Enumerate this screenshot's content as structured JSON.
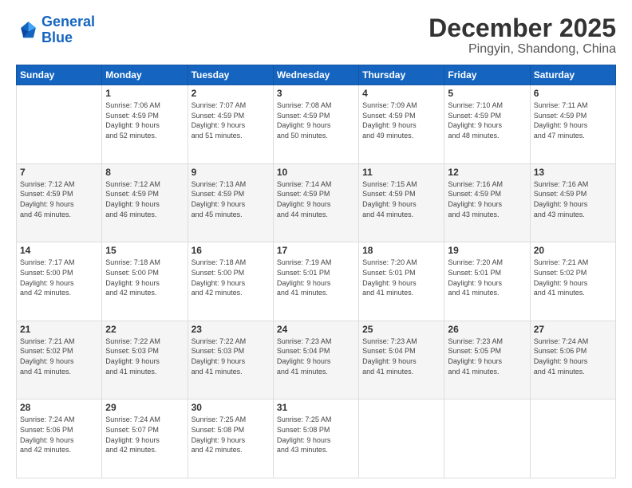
{
  "app": {
    "name1": "General",
    "name2": "Blue"
  },
  "title": "December 2025",
  "location": "Pingyin, Shandong, China",
  "days_of_week": [
    "Sunday",
    "Monday",
    "Tuesday",
    "Wednesday",
    "Thursday",
    "Friday",
    "Saturday"
  ],
  "weeks": [
    [
      {
        "day": "",
        "info": ""
      },
      {
        "day": "1",
        "info": "Sunrise: 7:06 AM\nSunset: 4:59 PM\nDaylight: 9 hours\nand 52 minutes."
      },
      {
        "day": "2",
        "info": "Sunrise: 7:07 AM\nSunset: 4:59 PM\nDaylight: 9 hours\nand 51 minutes."
      },
      {
        "day": "3",
        "info": "Sunrise: 7:08 AM\nSunset: 4:59 PM\nDaylight: 9 hours\nand 50 minutes."
      },
      {
        "day": "4",
        "info": "Sunrise: 7:09 AM\nSunset: 4:59 PM\nDaylight: 9 hours\nand 49 minutes."
      },
      {
        "day": "5",
        "info": "Sunrise: 7:10 AM\nSunset: 4:59 PM\nDaylight: 9 hours\nand 48 minutes."
      },
      {
        "day": "6",
        "info": "Sunrise: 7:11 AM\nSunset: 4:59 PM\nDaylight: 9 hours\nand 47 minutes."
      }
    ],
    [
      {
        "day": "7",
        "info": "Sunrise: 7:12 AM\nSunset: 4:59 PM\nDaylight: 9 hours\nand 46 minutes."
      },
      {
        "day": "8",
        "info": "Sunrise: 7:12 AM\nSunset: 4:59 PM\nDaylight: 9 hours\nand 46 minutes."
      },
      {
        "day": "9",
        "info": "Sunrise: 7:13 AM\nSunset: 4:59 PM\nDaylight: 9 hours\nand 45 minutes."
      },
      {
        "day": "10",
        "info": "Sunrise: 7:14 AM\nSunset: 4:59 PM\nDaylight: 9 hours\nand 44 minutes."
      },
      {
        "day": "11",
        "info": "Sunrise: 7:15 AM\nSunset: 4:59 PM\nDaylight: 9 hours\nand 44 minutes."
      },
      {
        "day": "12",
        "info": "Sunrise: 7:16 AM\nSunset: 4:59 PM\nDaylight: 9 hours\nand 43 minutes."
      },
      {
        "day": "13",
        "info": "Sunrise: 7:16 AM\nSunset: 4:59 PM\nDaylight: 9 hours\nand 43 minutes."
      }
    ],
    [
      {
        "day": "14",
        "info": "Sunrise: 7:17 AM\nSunset: 5:00 PM\nDaylight: 9 hours\nand 42 minutes."
      },
      {
        "day": "15",
        "info": "Sunrise: 7:18 AM\nSunset: 5:00 PM\nDaylight: 9 hours\nand 42 minutes."
      },
      {
        "day": "16",
        "info": "Sunrise: 7:18 AM\nSunset: 5:00 PM\nDaylight: 9 hours\nand 42 minutes."
      },
      {
        "day": "17",
        "info": "Sunrise: 7:19 AM\nSunset: 5:01 PM\nDaylight: 9 hours\nand 41 minutes."
      },
      {
        "day": "18",
        "info": "Sunrise: 7:20 AM\nSunset: 5:01 PM\nDaylight: 9 hours\nand 41 minutes."
      },
      {
        "day": "19",
        "info": "Sunrise: 7:20 AM\nSunset: 5:01 PM\nDaylight: 9 hours\nand 41 minutes."
      },
      {
        "day": "20",
        "info": "Sunrise: 7:21 AM\nSunset: 5:02 PM\nDaylight: 9 hours\nand 41 minutes."
      }
    ],
    [
      {
        "day": "21",
        "info": "Sunrise: 7:21 AM\nSunset: 5:02 PM\nDaylight: 9 hours\nand 41 minutes."
      },
      {
        "day": "22",
        "info": "Sunrise: 7:22 AM\nSunset: 5:03 PM\nDaylight: 9 hours\nand 41 minutes."
      },
      {
        "day": "23",
        "info": "Sunrise: 7:22 AM\nSunset: 5:03 PM\nDaylight: 9 hours\nand 41 minutes."
      },
      {
        "day": "24",
        "info": "Sunrise: 7:23 AM\nSunset: 5:04 PM\nDaylight: 9 hours\nand 41 minutes."
      },
      {
        "day": "25",
        "info": "Sunrise: 7:23 AM\nSunset: 5:04 PM\nDaylight: 9 hours\nand 41 minutes."
      },
      {
        "day": "26",
        "info": "Sunrise: 7:23 AM\nSunset: 5:05 PM\nDaylight: 9 hours\nand 41 minutes."
      },
      {
        "day": "27",
        "info": "Sunrise: 7:24 AM\nSunset: 5:06 PM\nDaylight: 9 hours\nand 41 minutes."
      }
    ],
    [
      {
        "day": "28",
        "info": "Sunrise: 7:24 AM\nSunset: 5:06 PM\nDaylight: 9 hours\nand 42 minutes."
      },
      {
        "day": "29",
        "info": "Sunrise: 7:24 AM\nSunset: 5:07 PM\nDaylight: 9 hours\nand 42 minutes."
      },
      {
        "day": "30",
        "info": "Sunrise: 7:25 AM\nSunset: 5:08 PM\nDaylight: 9 hours\nand 42 minutes."
      },
      {
        "day": "31",
        "info": "Sunrise: 7:25 AM\nSunset: 5:08 PM\nDaylight: 9 hours\nand 43 minutes."
      },
      {
        "day": "",
        "info": ""
      },
      {
        "day": "",
        "info": ""
      },
      {
        "day": "",
        "info": ""
      }
    ]
  ]
}
